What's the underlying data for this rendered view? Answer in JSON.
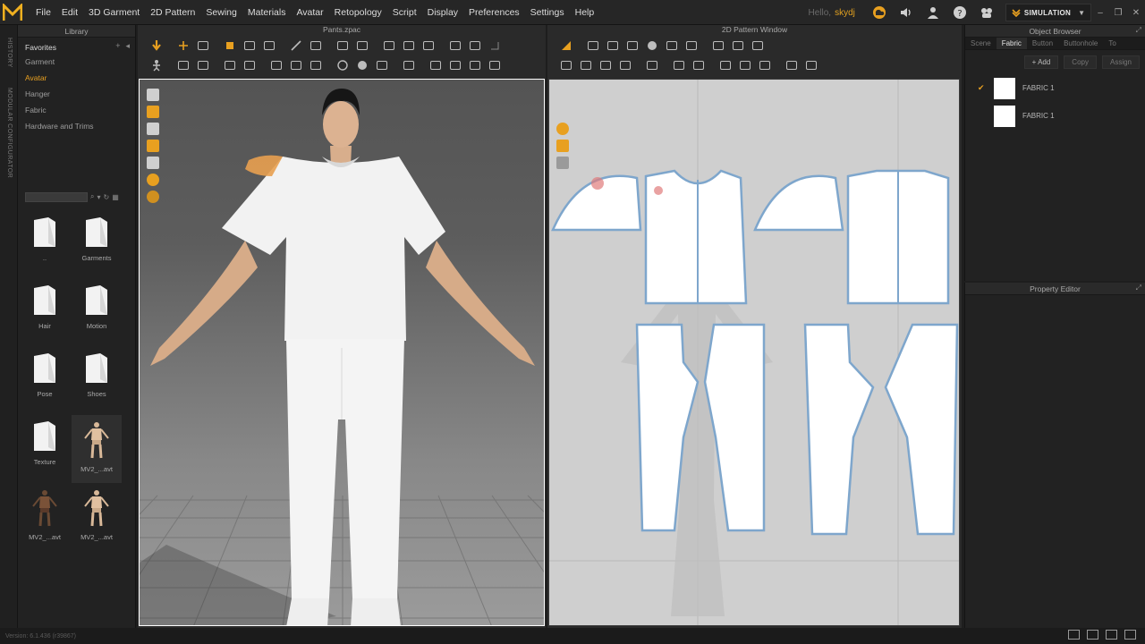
{
  "app": {
    "menu": [
      "File",
      "Edit",
      "3D Garment",
      "2D Pattern",
      "Sewing",
      "Materials",
      "Avatar",
      "Retopology",
      "Script",
      "Display",
      "Preferences",
      "Settings",
      "Help"
    ],
    "user_greeting": "Hello,",
    "user_name": "skydj",
    "mode": "SIMULATION",
    "accent_color": "#e8a020"
  },
  "history_strip": {
    "history_label": "HISTORY",
    "modular_label": "MODULAR CONFIGURATOR"
  },
  "library": {
    "title": "Library",
    "favorites_title": "Favorites",
    "favorites": [
      "Garment",
      "Avatar",
      "Hanger",
      "Fabric",
      "Hardware and Trims"
    ],
    "active_favorite": "Avatar",
    "items": [
      {
        "label": "..",
        "kind": "folder"
      },
      {
        "label": "Garments",
        "kind": "folder"
      },
      {
        "label": "Hair",
        "kind": "folder"
      },
      {
        "label": "Motion",
        "kind": "folder"
      },
      {
        "label": "Pose",
        "kind": "folder"
      },
      {
        "label": "Shoes",
        "kind": "folder"
      },
      {
        "label": "Texture",
        "kind": "folder"
      },
      {
        "label": "MV2_...avt",
        "kind": "avatar-light"
      },
      {
        "label": "MV2_...avt",
        "kind": "avatar-dark"
      },
      {
        "label": "MV2_...avt",
        "kind": "avatar-light"
      }
    ]
  },
  "view3d": {
    "title": "Pants.zpac"
  },
  "pattern2d": {
    "title": "2D Pattern Window"
  },
  "object_browser": {
    "title": "Object Browser",
    "tabs": [
      "Scene",
      "Fabric",
      "Button",
      "Buttonhole",
      "To"
    ],
    "active_tab": "Fabric",
    "add_label": "+ Add",
    "copy_label": "Copy",
    "assign_label": "Assign",
    "fabrics": [
      {
        "name": "FABRIC 1",
        "checked": true
      },
      {
        "name": "FABRIC 1",
        "checked": false
      }
    ]
  },
  "property_editor": {
    "title": "Property Editor"
  },
  "status": {
    "version": "Version: 6.1.436 (r39867)"
  }
}
